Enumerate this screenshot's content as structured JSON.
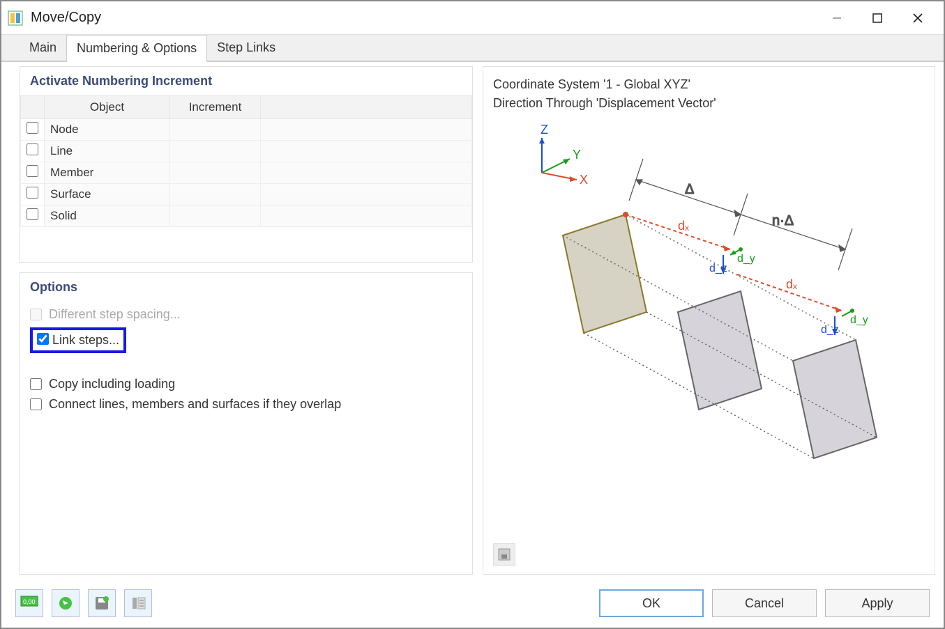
{
  "window": {
    "title": "Move/Copy"
  },
  "tabs": [
    "Main",
    "Numbering & Options",
    "Step Links"
  ],
  "active_tab": "Numbering & Options",
  "numbering": {
    "header": "Activate Numbering Increment",
    "cols": [
      "Object",
      "Increment"
    ],
    "rows": [
      {
        "obj": "Node",
        "inc": ""
      },
      {
        "obj": "Line",
        "inc": ""
      },
      {
        "obj": "Member",
        "inc": ""
      },
      {
        "obj": "Surface",
        "inc": ""
      },
      {
        "obj": "Solid",
        "inc": ""
      }
    ]
  },
  "options": {
    "header": "Options",
    "items": [
      {
        "label": "Different step spacing...",
        "checked": false,
        "disabled": true,
        "highlighted": false
      },
      {
        "label": "Link steps...",
        "checked": true,
        "disabled": false,
        "highlighted": true
      },
      {
        "label": "Copy including loading",
        "checked": false,
        "disabled": false,
        "highlighted": false
      },
      {
        "label": "Connect lines, members and surfaces if they overlap",
        "checked": false,
        "disabled": false,
        "highlighted": false
      }
    ]
  },
  "preview": {
    "line1": "Coordinate System '1 - Global XYZ'",
    "line2": "Direction Through 'Displacement Vector'"
  },
  "buttons": {
    "ok": "OK",
    "cancel": "Cancel",
    "apply": "Apply"
  }
}
